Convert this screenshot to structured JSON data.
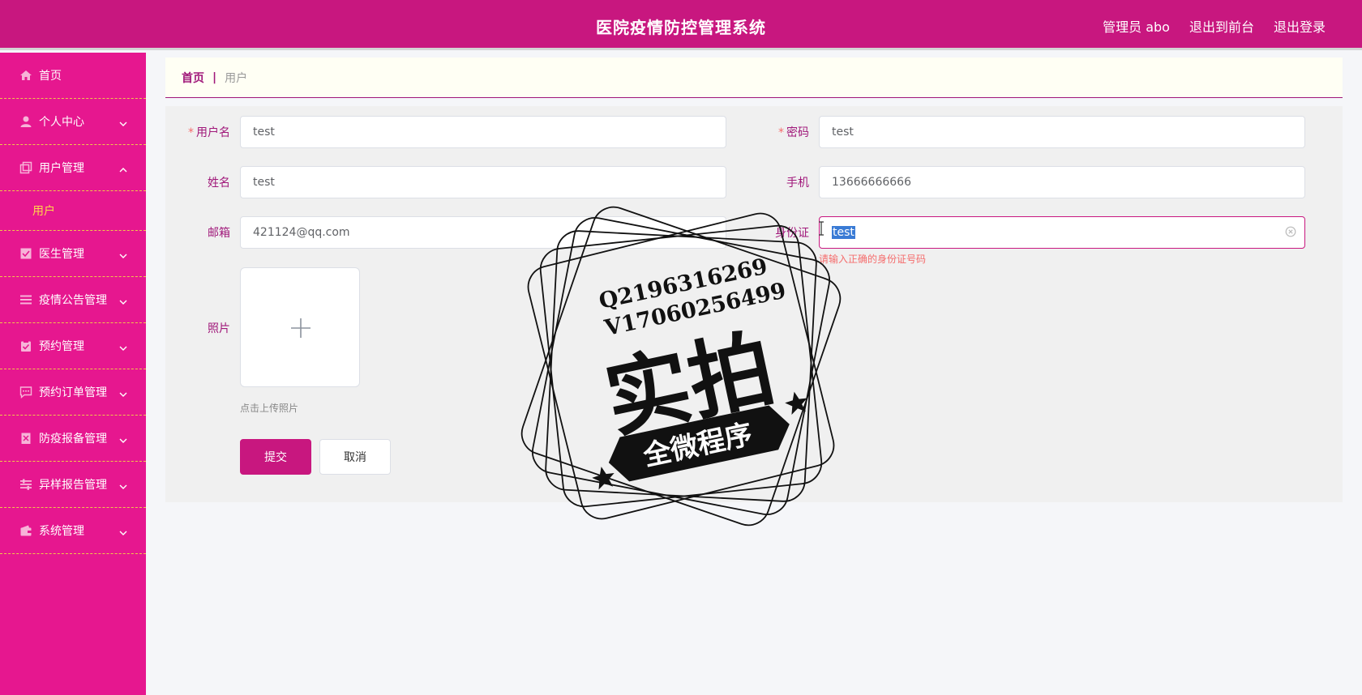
{
  "header": {
    "title": "医院疫情防控管理系统",
    "user_label": "管理员 abo",
    "front_link": "退出到前台",
    "logout_link": "退出登录"
  },
  "sidebar": {
    "items": [
      {
        "label": "首页",
        "icon": "home-icon"
      },
      {
        "label": "个人中心",
        "icon": "user-icon",
        "chevron": "down"
      },
      {
        "label": "用户管理",
        "icon": "copy-icon",
        "chevron": "up"
      },
      {
        "label": "用户",
        "sub": true,
        "active": true
      },
      {
        "label": "医生管理",
        "icon": "checked-box-icon",
        "chevron": "down"
      },
      {
        "label": "疫情公告管理",
        "icon": "list-icon",
        "chevron": "down"
      },
      {
        "label": "预约管理",
        "icon": "clipboard-check-icon",
        "chevron": "down"
      },
      {
        "label": "预约订单管理",
        "icon": "chat-icon",
        "chevron": "down"
      },
      {
        "label": "防疫报备管理",
        "icon": "report-icon",
        "chevron": "down"
      },
      {
        "label": "异样报告管理",
        "icon": "sliders-icon",
        "chevron": "down"
      },
      {
        "label": "系统管理",
        "icon": "wallet-icon",
        "chevron": "down"
      }
    ]
  },
  "breadcrumb": {
    "home": "首页",
    "separator": "|",
    "current": "用户"
  },
  "form": {
    "username": {
      "label": "用户名",
      "required": "*",
      "value": "test"
    },
    "password": {
      "label": "密码",
      "required": "*",
      "value": "test"
    },
    "name": {
      "label": "姓名",
      "value": "test"
    },
    "phone": {
      "label": "手机",
      "value": "13666666666"
    },
    "email": {
      "label": "邮箱",
      "value": "421124@qq.com"
    },
    "id_card": {
      "label": "身份证",
      "value": "test",
      "error": "请输入正确的身份证号码"
    },
    "photo": {
      "label": "照片",
      "tip": "点击上传照片"
    },
    "submit_label": "提交",
    "cancel_label": "取消"
  },
  "watermark": {
    "line1": "Q2196316269",
    "line2": "V17060256499",
    "main": "实拍",
    "banner": "全微程序"
  },
  "colors": {
    "header_bg": "#c8177f",
    "sidebar_bg": "#e6178f",
    "sidebar_divider": "#f0c84a",
    "active_sub": "#ffd84a",
    "accent": "#a0187a",
    "error": "#f56c6c"
  }
}
